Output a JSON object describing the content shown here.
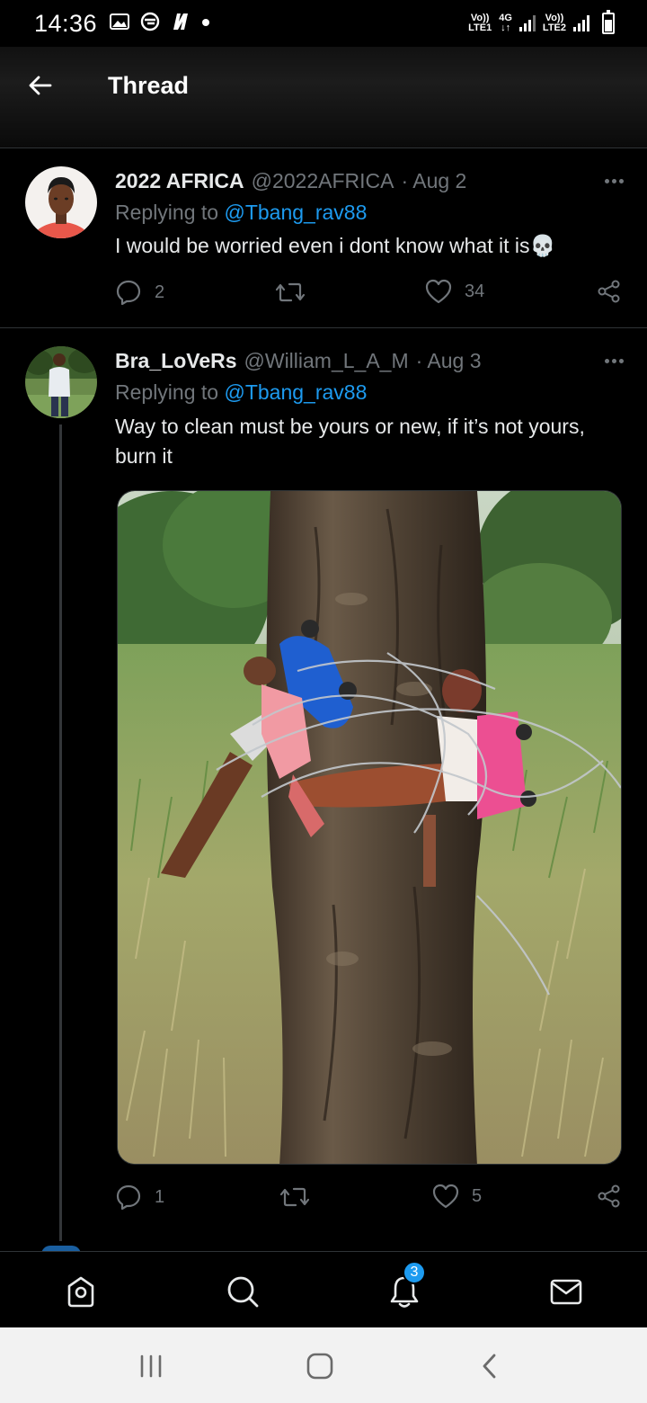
{
  "status_bar": {
    "time": "14:36",
    "sim1_label_top": "Vo))",
    "sim1_label_bottom": "LTE1",
    "network_type": "4G",
    "sim2_label_top": "Vo))",
    "sim2_label_bottom": "LTE2",
    "icons": [
      "gallery-icon",
      "vpn-icon",
      "netflix-icon",
      "dot-icon"
    ]
  },
  "header": {
    "title": "Thread",
    "back_icon": "arrow-left-icon"
  },
  "tweets": [
    {
      "display_name": "2022 AFRICA",
      "handle": "@2022AFRICA",
      "date": "· Aug 2",
      "replying_prefix": "Replying to ",
      "replying_to": "@Tbang_rav88",
      "text": "I would be worried even i dont know what it is💀",
      "replies": "2",
      "retweets": "",
      "likes": "34"
    },
    {
      "display_name": "Bra_LoVeRs",
      "handle": "@William_L_A_M",
      "date": "· Aug 3",
      "replying_prefix": "Replying to ",
      "replying_to": "@Tbang_rav88",
      "text": "Way to clean must be yours or new, if it’s not yours, burn it",
      "replies": "1",
      "retweets": "",
      "likes": "5"
    }
  ],
  "bottom_nav": {
    "items": [
      "home-icon",
      "search-icon",
      "notifications-icon",
      "messages-icon"
    ],
    "notification_count": "3"
  },
  "colors": {
    "accent": "#1d9bf0",
    "muted": "#71767b",
    "text": "#e7e9ea",
    "background": "#000000",
    "divider": "#2f3336"
  }
}
